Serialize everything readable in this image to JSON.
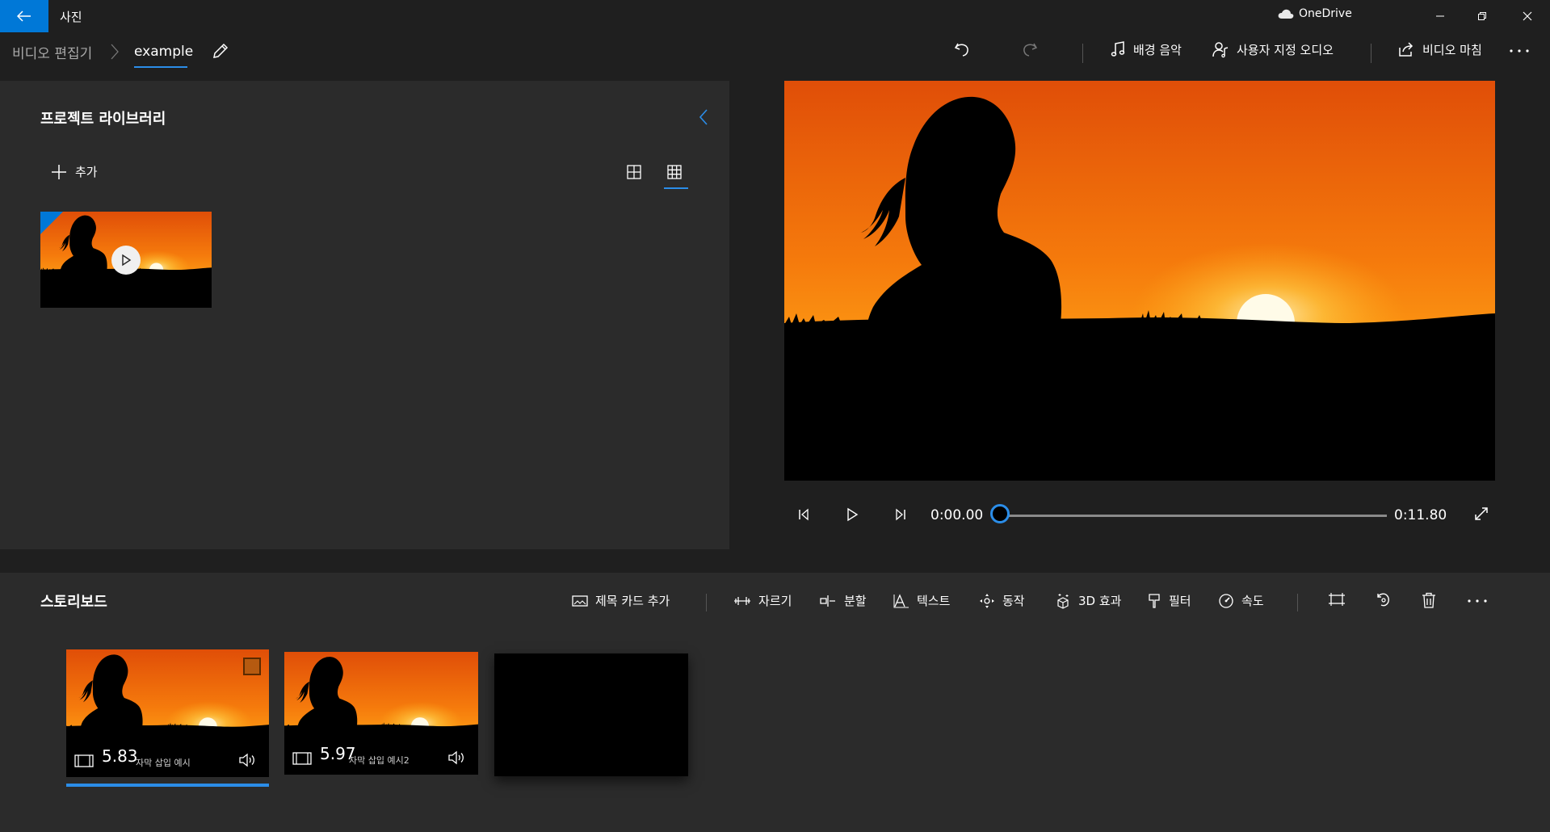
{
  "app": {
    "title": "사진",
    "onedrive_label": "OneDrive"
  },
  "breadcrumb": {
    "root": "비디오 편집기",
    "project": "example"
  },
  "toolbar": {
    "background_music": "배경 음악",
    "custom_audio": "사용자 지정 오디오",
    "finish_video": "비디오 마침"
  },
  "library": {
    "title": "프로젝트 라이브러리",
    "add_label": "추가"
  },
  "player": {
    "current_time": "0:00.00",
    "total_time": "0:11.80",
    "progress": 0
  },
  "storyboard": {
    "title": "스토리보드",
    "tools": {
      "title_card": "제목 카드 추가",
      "trim": "자르기",
      "split": "분할",
      "text": "텍스트",
      "motion": "동작",
      "effects_3d": "3D 효과",
      "filters": "필터",
      "speed": "속도"
    },
    "clips": [
      {
        "duration": "5.83",
        "caption": "자막 삽입 예시",
        "selected": true
      },
      {
        "duration": "5.97",
        "caption": "자막 삽입 예시2",
        "selected": false
      }
    ]
  },
  "colors": {
    "accent": "#0078d7",
    "sky_top": "#e85a0a",
    "sky_mid": "#f7840d",
    "sky_horizon": "#ffb01a",
    "panel": "#2b2b2b",
    "background": "#1f1f1f"
  },
  "icons": [
    "back-arrow-icon",
    "onedrive-cloud-icon",
    "minimize-icon",
    "restore-icon",
    "close-icon",
    "chevron-right-icon",
    "pencil-icon",
    "undo-icon",
    "redo-icon",
    "music-note-icon",
    "custom-audio-icon",
    "share-icon",
    "more-icon",
    "chevron-left-icon",
    "plus-icon",
    "grid-small-icon",
    "grid-large-icon",
    "play-icon",
    "step-back-icon",
    "step-forward-icon",
    "fullscreen-icon",
    "title-card-icon",
    "trim-icon",
    "split-icon",
    "text-icon",
    "motion-icon",
    "3d-effects-icon",
    "filter-icon",
    "speed-icon",
    "resize-icon",
    "rotate-icon",
    "delete-icon",
    "film-icon",
    "volume-icon"
  ]
}
